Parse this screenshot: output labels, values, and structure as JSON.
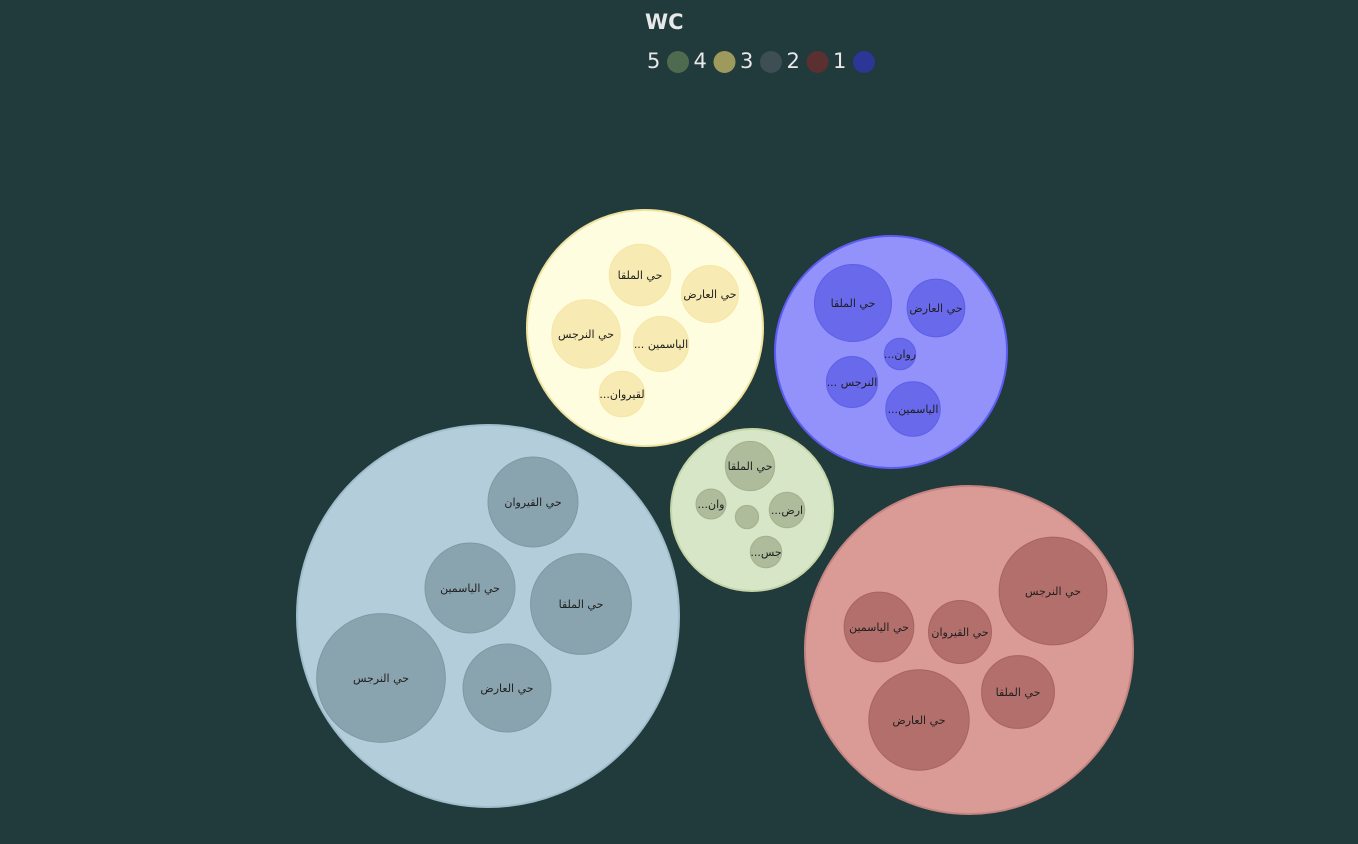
{
  "chart_data": {
    "type": "packed-bubble",
    "legend": {
      "title": "WC",
      "placement": "top-center",
      "items": [
        {
          "label": "5",
          "color": "#4f6b4f"
        },
        {
          "label": "4",
          "color": "#9e9a5e"
        },
        {
          "label": "3",
          "color": "#3d4f55"
        },
        {
          "label": "2",
          "color": "#5a3030"
        },
        {
          "label": "1",
          "color": "#2d3596"
        }
      ]
    },
    "groups": [
      {
        "wc": "4",
        "color": "#fffde0",
        "stroke": "#f0e3a0",
        "child_color": "#f5e6a6",
        "children": [
          {
            "label": "حي الملقا",
            "value": 4.2
          },
          {
            "label": "حي العارض",
            "value": 3.6
          },
          {
            "label": "حي النرجس",
            "value": 5.2
          },
          {
            "label": "... الياسمين",
            "value": 3.4
          },
          {
            "label": "...لقيروان",
            "value": 2.3
          }
        ]
      },
      {
        "wc": "1",
        "color": "#9292fa",
        "stroke": "#5c5cf2",
        "child_color": "#5e5ee8",
        "children": [
          {
            "label": "حي الملقا",
            "value": 6.6
          },
          {
            "label": "حي العارض",
            "value": 3.7
          },
          {
            "label": "...روان",
            "value": 1.1
          },
          {
            "label": "... النرجس",
            "value": 2.9
          },
          {
            "label": "...الياسمين",
            "value": 3.3
          }
        ]
      },
      {
        "wc": "5",
        "color": "#d6e6c6",
        "stroke": "#c4d6a8",
        "child_color": "#a3b08e",
        "children": [
          {
            "label": "حي الملقا",
            "value": 2.7
          },
          {
            "label": "...وان",
            "value": 1.0
          },
          {
            "label": "",
            "value": 0.6
          },
          {
            "label": "...ارض",
            "value": 1.4
          },
          {
            "label": "...جس",
            "value": 1.1
          }
        ]
      },
      {
        "wc": "3",
        "color": "#b3ceda",
        "stroke": "#9fbecb",
        "child_color": "#7f99a3",
        "children": [
          {
            "label": "حي القيروان",
            "value": 9.0
          },
          {
            "label": "حي الياسمين",
            "value": 9.0
          },
          {
            "label": "حي الملقا",
            "value": 11.3
          },
          {
            "label": "حي النرجس",
            "value": 18.4
          },
          {
            "label": "حي العارض",
            "value": 8.6
          }
        ]
      },
      {
        "wc": "2",
        "color": "#da9a96",
        "stroke": "#c48480",
        "child_color": "#a8635f",
        "children": [
          {
            "label": "حي النرجس",
            "value": 12.9
          },
          {
            "label": "حي الياسمين",
            "value": 5.4
          },
          {
            "label": "حي القيروان",
            "value": 4.4
          },
          {
            "label": "حي الملقا",
            "value": 5.9
          },
          {
            "label": "حي العارض",
            "value": 11.2
          }
        ]
      }
    ]
  }
}
